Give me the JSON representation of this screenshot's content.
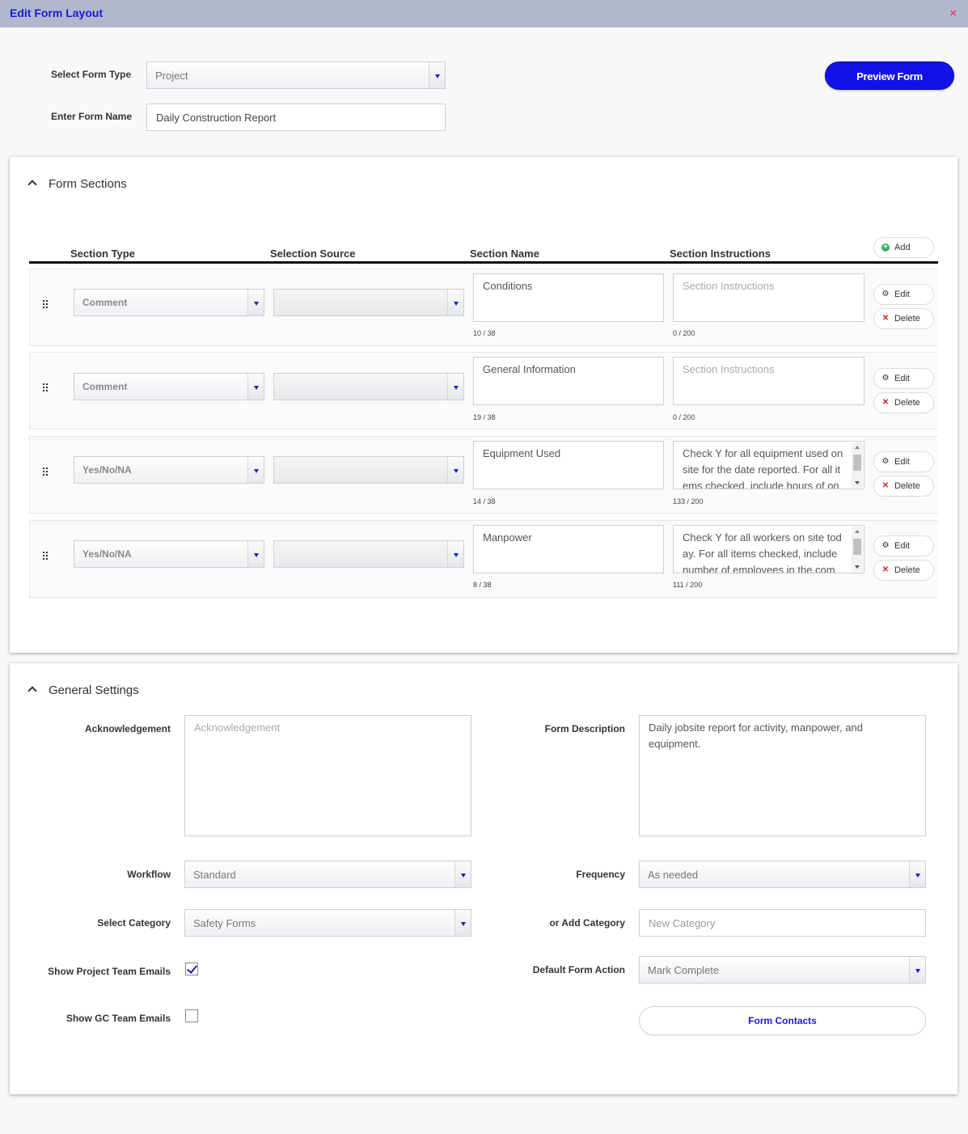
{
  "header": {
    "title": "Edit Form Layout",
    "close_glyph": "×"
  },
  "form": {
    "type_label": "Select Form Type",
    "type_value": "Project",
    "name_label": "Enter Form Name",
    "name_value": "Daily Construction Report",
    "preview_label": "Preview Form"
  },
  "sections": {
    "title": "Form Sections",
    "columns": [
      "Section Type",
      "Selection Source",
      "Section Name",
      "Section Instructions"
    ],
    "add_label": "Add",
    "edit_label": "Edit",
    "delete_label": "Delete",
    "instructions_placeholder": "Section Instructions",
    "rows": [
      {
        "type": "Comment",
        "source": "",
        "name": "Conditions",
        "name_count": "10 / 38",
        "instructions": "",
        "instr_count": "0 / 200"
      },
      {
        "type": "Comment",
        "source": "",
        "name": "General Information",
        "name_count": "19 / 38",
        "instructions": "",
        "instr_count": "0 / 200"
      },
      {
        "type": "Yes/No/NA",
        "source": "",
        "name": "Equipment Used",
        "name_count": "14 / 38",
        "instructions": "Check Y for all equipment used on site for the date reported. For all it ems checked, include hours of on",
        "instr_count": "133 / 200"
      },
      {
        "type": "Yes/No/NA",
        "source": "",
        "name": "Manpower",
        "name_count": "8 / 38",
        "instructions": "Check Y for all workers on site tod ay. For all items checked, include number of employees in the com",
        "instr_count": "111 / 200"
      }
    ]
  },
  "settings": {
    "title": "General Settings",
    "ack_label": "Acknowledgement",
    "ack_placeholder": "Acknowledgement",
    "desc_label": "Form Description",
    "desc_value": "Daily jobsite report for activity, manpower, and equipment.",
    "workflow_label": "Workflow",
    "workflow_value": "Standard",
    "frequency_label": "Frequency",
    "frequency_value": "As needed",
    "category_label": "Select Category",
    "category_value": "Safety Forms",
    "add_category_label": "or Add Category",
    "add_category_placeholder": "New Category",
    "project_emails_label": "Show Project Team Emails",
    "project_emails_checked": true,
    "gc_emails_label": "Show GC Team Emails",
    "gc_emails_checked": false,
    "default_action_label": "Default Form Action",
    "default_action_value": "Mark Complete",
    "contacts_label": "Form Contacts"
  },
  "colors": {
    "accent": "#1212e8",
    "titlebar": "#b1b8cb",
    "close": "#e8437a",
    "add": "#2fb75a",
    "delete": "#e02020"
  },
  "icons": [
    "close-icon",
    "chevron-up-icon",
    "drag-handle-icon",
    "plus-circle-icon",
    "gear-icon",
    "x-icon",
    "dropdown-caret-icon",
    "checkmark-icon"
  ]
}
